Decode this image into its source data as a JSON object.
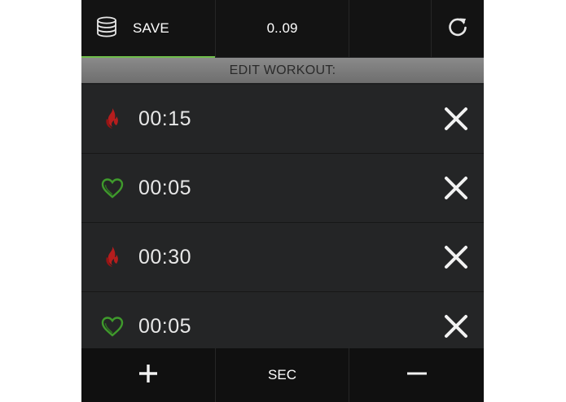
{
  "toolbar": {
    "save_icon": "database-icon",
    "save_label": "SAVE",
    "time_display": "0..09",
    "reset_icon": "refresh-icon",
    "accent_color": "#6fbe4a"
  },
  "header": {
    "title": "EDIT WORKOUT:"
  },
  "intervals": [
    {
      "type": "flame-icon",
      "time": "00:15",
      "color": "#b51d1d"
    },
    {
      "type": "heart-icon",
      "time": "00:05",
      "color": "#3f9a2c"
    },
    {
      "type": "flame-icon",
      "time": "00:30",
      "color": "#b51d1d"
    },
    {
      "type": "heart-icon",
      "time": "00:05",
      "color": "#3f9a2c"
    }
  ],
  "bottombar": {
    "add_icon": "plus-icon",
    "unit_label": "SEC",
    "remove_icon": "minus-icon"
  }
}
